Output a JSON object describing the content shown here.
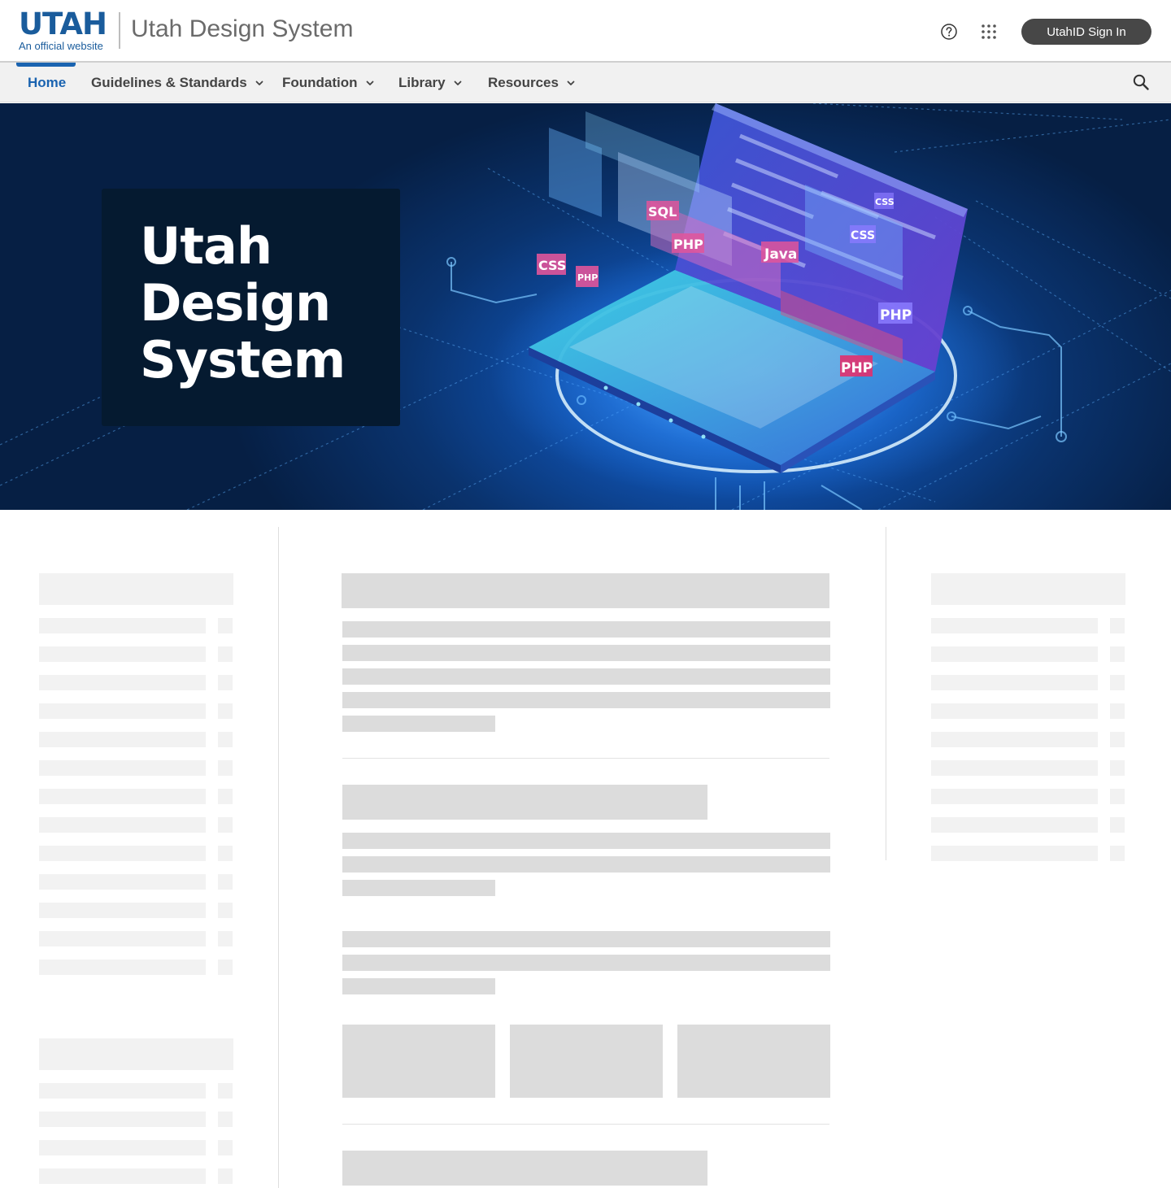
{
  "header": {
    "logo": {
      "word": "UTAH",
      "subtitle": "An official website"
    },
    "site_title": "Utah Design System",
    "help_label": "Help",
    "apps_label": "Utah.gov apps",
    "signin_label": "UtahID Sign In"
  },
  "nav": {
    "items": [
      {
        "label": "Home",
        "active": true,
        "has_menu": false
      },
      {
        "label": "Guidelines & Standards",
        "active": false,
        "has_menu": true
      },
      {
        "label": "Foundation",
        "active": false,
        "has_menu": true
      },
      {
        "label": "Library",
        "active": false,
        "has_menu": true
      },
      {
        "label": "Resources",
        "active": false,
        "has_menu": true
      }
    ],
    "search_icon": "search-icon"
  },
  "hero": {
    "title_lines": [
      "Utah",
      "Design",
      "System"
    ],
    "background_labels": [
      "CSS",
      "PHP",
      "SQL",
      "Java",
      "CSS",
      "PHP",
      "PHP",
      "PHP",
      "CSS"
    ]
  },
  "colors": {
    "brand_blue": "#1a63b0",
    "signin_bg": "#474747",
    "nav_bg": "#f1f1f1",
    "hero_card_bg": "#051a30",
    "skeleton_light": "#f2f2f2",
    "skeleton_dark": "#dcdcdc"
  },
  "content_state": "loading-skeleton"
}
